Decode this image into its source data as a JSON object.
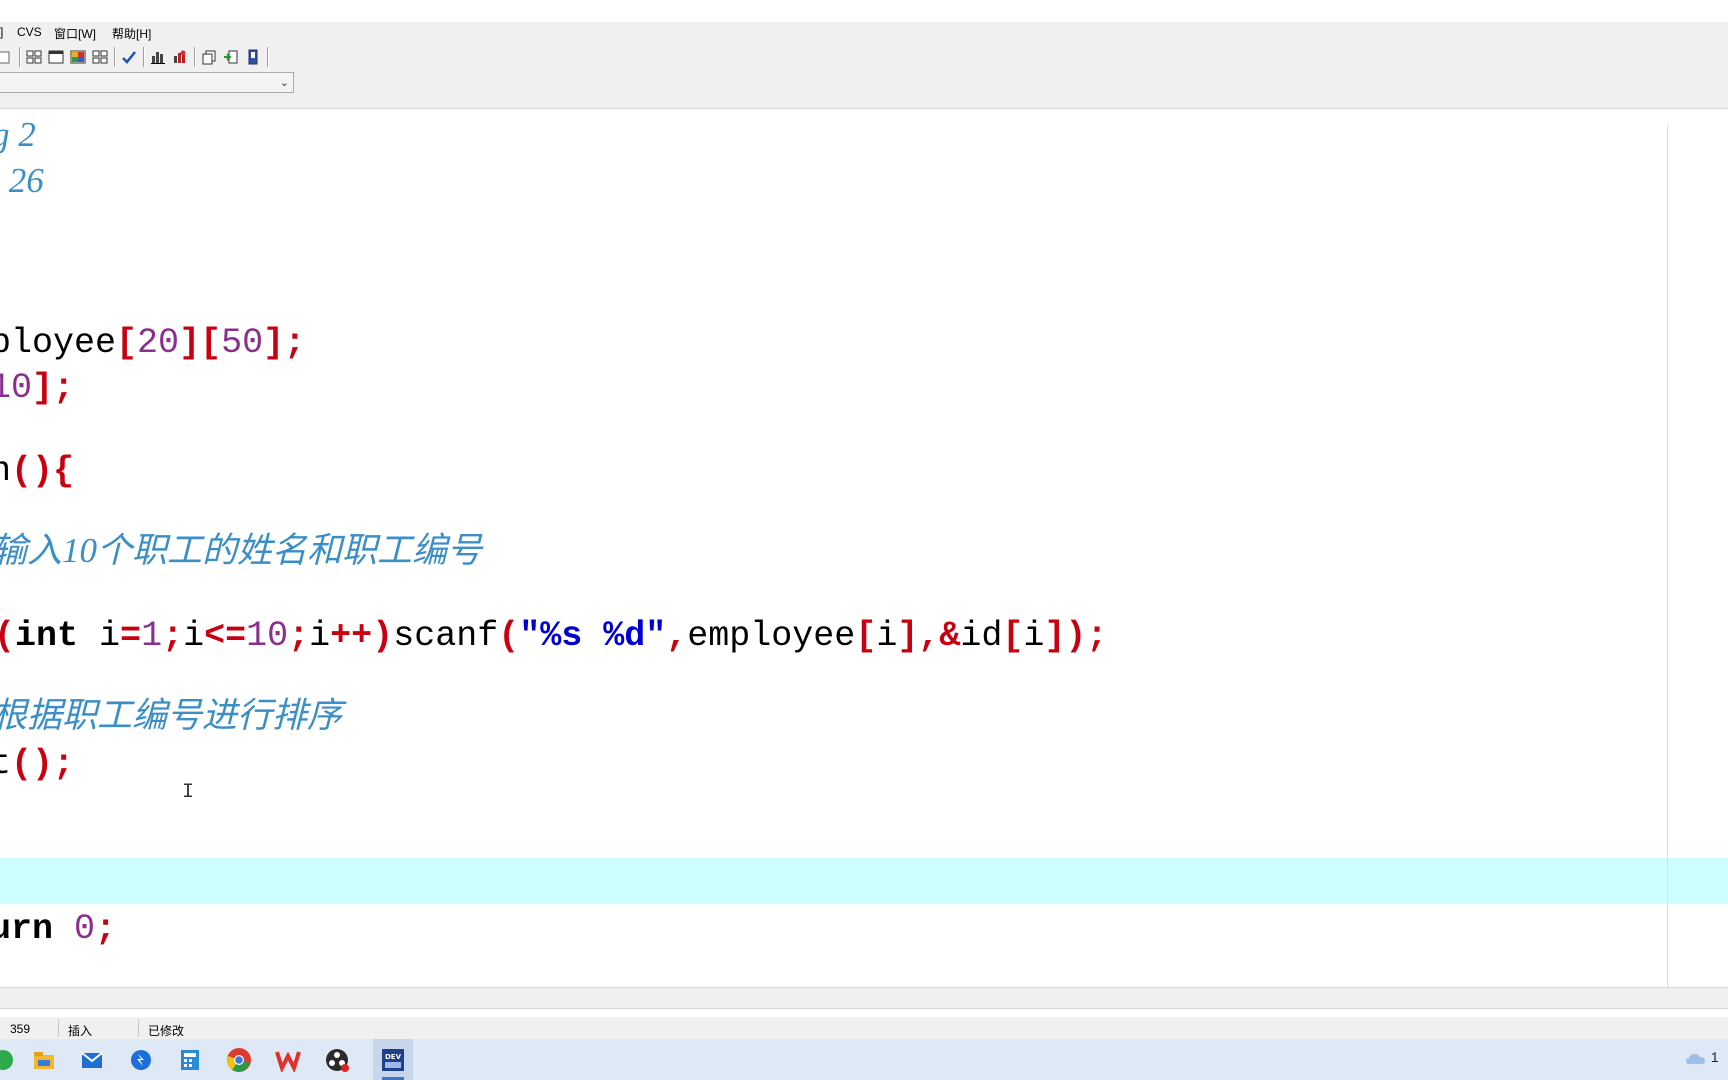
{
  "menu": {
    "items": [
      "]",
      "CVS",
      "窗口[W]",
      "帮助[H]"
    ]
  },
  "toolbar": {
    "icons": [
      "page-icon",
      "tile-icon",
      "window-icon",
      "grid-color-icon",
      "grid-icon",
      "check-icon",
      "chart-icon",
      "chart-red-icon",
      "copy-icon",
      "insert-green-icon",
      "bookmark-icon"
    ]
  },
  "combo": {
    "value": ""
  },
  "editor": {
    "lines": [
      {
        "tokens": [
          {
            "t": "cmt",
            "v": "g 2"
          }
        ]
      },
      {
        "tokens": [
          {
            "t": "cmt",
            "v": " 26"
          }
        ]
      },
      {
        "tokens": [
          {
            "t": "plain",
            "v": "ployee"
          },
          {
            "t": "sym",
            "v": "["
          },
          {
            "t": "num",
            "v": "20"
          },
          {
            "t": "sym",
            "v": "]["
          },
          {
            "t": "num",
            "v": "50"
          },
          {
            "t": "sym",
            "v": "];"
          }
        ]
      },
      {
        "tokens": [
          {
            "t": "num",
            "v": "10"
          },
          {
            "t": "sym",
            "v": "];"
          }
        ]
      },
      {
        "tokens": [
          {
            "t": "plain",
            "v": "n"
          },
          {
            "t": "sym",
            "v": "(){"
          }
        ]
      },
      {
        "tokens": [
          {
            "t": "cmt",
            "v": "输入10个职工的姓名和职工编号"
          }
        ]
      },
      {
        "tokens": [
          {
            "t": "sym",
            "v": "("
          },
          {
            "t": "kw",
            "v": "int"
          },
          {
            "t": "plain",
            "v": " i"
          },
          {
            "t": "sym",
            "v": "="
          },
          {
            "t": "num",
            "v": "1"
          },
          {
            "t": "sym",
            "v": ";"
          },
          {
            "t": "plain",
            "v": "i"
          },
          {
            "t": "sym",
            "v": "<="
          },
          {
            "t": "num",
            "v": "10"
          },
          {
            "t": "sym",
            "v": ";"
          },
          {
            "t": "plain",
            "v": "i"
          },
          {
            "t": "sym",
            "v": "++)"
          },
          {
            "t": "plain",
            "v": "scanf"
          },
          {
            "t": "sym",
            "v": "("
          },
          {
            "t": "str",
            "v": "\"%s %d\""
          },
          {
            "t": "sym",
            "v": ","
          },
          {
            "t": "plain",
            "v": "employee"
          },
          {
            "t": "sym",
            "v": "["
          },
          {
            "t": "plain",
            "v": "i"
          },
          {
            "t": "sym",
            "v": "],&"
          },
          {
            "t": "plain",
            "v": "id"
          },
          {
            "t": "sym",
            "v": "["
          },
          {
            "t": "plain",
            "v": "i"
          },
          {
            "t": "sym",
            "v": "]);"
          }
        ]
      },
      {
        "tokens": [
          {
            "t": "cmt",
            "v": "根据职工编号进行排序"
          }
        ]
      },
      {
        "tokens": [
          {
            "t": "plain",
            "v": "t"
          },
          {
            "t": "sym",
            "v": "();"
          }
        ]
      },
      {
        "tokens": [
          {
            "t": "kw",
            "v": "urn"
          },
          {
            "t": "plain",
            "v": " "
          },
          {
            "t": "num",
            "v": "0"
          },
          {
            "t": "sym",
            "v": ";"
          }
        ]
      }
    ]
  },
  "status": {
    "line": "359",
    "mode": "插入",
    "modified": "已修改"
  },
  "taskbar": {
    "apps": [
      "green-app-icon",
      "file-explorer-icon",
      "mail-icon",
      "feishu-icon",
      "calculator-icon",
      "chrome-icon",
      "wps-icon",
      "obs-icon",
      "devcpp-icon"
    ],
    "tray_text": "1"
  }
}
